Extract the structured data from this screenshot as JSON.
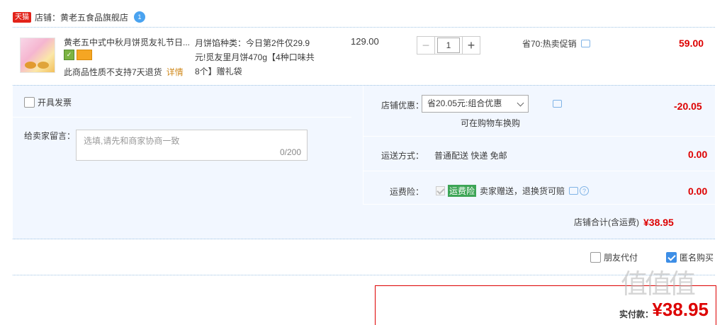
{
  "shop": {
    "badge": "天猫",
    "label": "店铺：黄老五食品旗舰店",
    "ww_badge": "1"
  },
  "item": {
    "title": "黄老五中式中秋月饼觅友礼节日...",
    "no_return": "此商品性质不支持7天退货",
    "detail_link": "详情",
    "sku_line1": "月饼馅种类：今日第2件仅29.9",
    "sku_line2": "元!觅友里月饼470g【4种口味共",
    "sku_line3": "8个】赠礼袋",
    "price": "129.00",
    "qty": "1",
    "minus": "−",
    "plus": "+",
    "promo": "省70:热卖促销",
    "total": "59.00"
  },
  "panel": {
    "invoice_label": "开具发票",
    "msg_label": "给卖家留言：",
    "msg_placeholder": "选填,请先和商家协商一致",
    "msg_count": "0/200",
    "discount_label": "店铺优惠：",
    "discount_select": "省20.05元:组合优惠",
    "discount_note": "可在购物车换购",
    "discount_value": "-20.05",
    "shipping_label": "运送方式：",
    "shipping_value": "普通配送 快递 免邮",
    "shipping_amount": "0.00",
    "insurance_label": "运费险：",
    "insurance_tag": "运费险",
    "insurance_text": "卖家赠送，退换货可赔",
    "insurance_amount": "0.00",
    "shop_total_label": "店铺合计(含运费)",
    "shop_total_amount": "¥38.95"
  },
  "options": {
    "friend_pay": "朋友代付",
    "anonymous": "匿名购买"
  },
  "pay": {
    "label": "实付款：",
    "amount": "¥38.95"
  },
  "watermark": "值值值"
}
